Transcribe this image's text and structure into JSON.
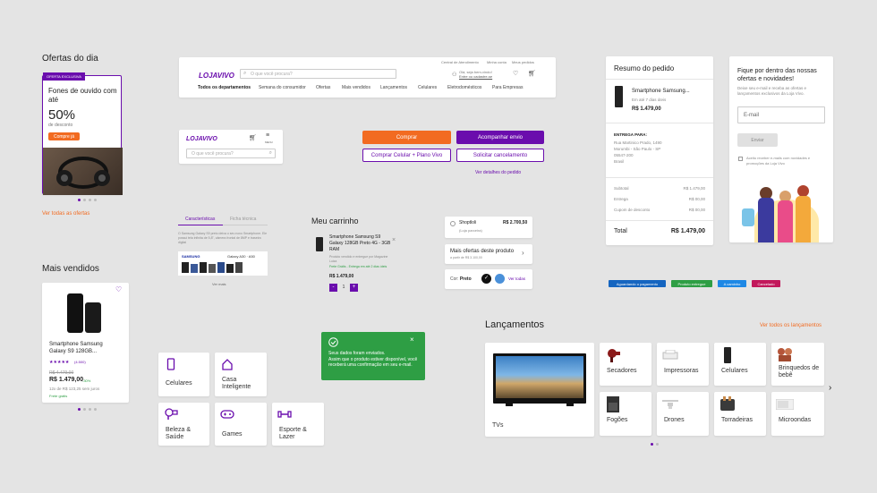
{
  "ofertas": {
    "title": "Ofertas do dia",
    "tag": "OFERTA EXCLUSIVA",
    "headline": "Fones de ouvido com até",
    "percent": "50%",
    "percent_sub": "de desconto",
    "cta": "Compre já",
    "link": "Ver todas as ofertas"
  },
  "header": {
    "logo": "LOJAVIVO",
    "search_placeholder": "O que você procura?",
    "top_links": [
      "Central de Atendimento",
      "Minha conta",
      "Meus pedidos"
    ],
    "greeting": "Olá, seja bem-vindo!",
    "greeting_link": "Entre ou cadastre-se",
    "nav": [
      "Todos os departamentos",
      "Semana do consumidor",
      "Ofertas",
      "Mais vendidos",
      "Lançamentos",
      "Celulares",
      "Eletrodomésticos",
      "Para Empresas"
    ]
  },
  "mobile_header": {
    "logo": "LOJAVIVO",
    "menu_label": "MENU",
    "search_placeholder": "O que você procura?"
  },
  "buttons": {
    "comprar": "Comprar",
    "acompanhar": "Acompanhar envio",
    "comprar_celular": "Comprar Celular + Plano Vivo",
    "solicitar": "Solicitar cancelamento",
    "ver_detalhes": "Ver detalhes do pedido"
  },
  "tabs": {
    "items": [
      "Características",
      "Ficha técnica"
    ],
    "text": "O Samsung Galaxy S9 preto deixa o seu novo Smartphone. Ele possui tela infinita de 5,8\", câmera frontal de 8MP e traseira digital",
    "image_brand": "SAMSUNG",
    "image_model": "Galaxy A30 · A50",
    "more": "Ver mais"
  },
  "carrinho": {
    "title": "Meu carrinho",
    "product": "Smartphone Samsung S9 Galaxy 128GB Preto 4G - 3GB RAM",
    "seller": "Produto vendido e entregue por Magazine Luiza",
    "shipping": "Frete Grátis - Entrega em até 2 dias úteis",
    "price": "R$ 1.479,00",
    "qty": "1",
    "minus": "-",
    "plus": "+"
  },
  "option": {
    "name": "Shoptloli",
    "sub": "(Loja parceira)",
    "price": "R$ 2.700,50"
  },
  "mais_ofertas": {
    "label": "Mais ofertas deste produto",
    "sub": "a partir de R$ 3.100,00"
  },
  "cor": {
    "label": "Cor:",
    "value": "Preto",
    "link": "Ver todas",
    "colors": [
      "#111111",
      "#4a90d9"
    ]
  },
  "mais_vendidos": {
    "title": "Mais vendidos",
    "product": "Smartphone Samsung Galaxy S9 128GB...",
    "reviews": "(4.500)",
    "stars": "★★★★★",
    "old_price": "R$ 4.479,00",
    "price": "R$ 1.479,00",
    "discount": "-30%",
    "installments": "12x de R$ 123,25 sem juros",
    "shipping": "Frete grátis"
  },
  "categories_small": [
    {
      "label": "Celulares",
      "icon": "phone-icon"
    },
    {
      "label": "Casa Inteligente",
      "icon": "house-icon"
    },
    {
      "label": "Beleza & Saúde",
      "icon": "hairdryer-icon"
    },
    {
      "label": "Games",
      "icon": "gamepad-icon"
    },
    {
      "label": "Esporte & Lazer",
      "icon": "dumbbell-icon"
    }
  ],
  "toast": {
    "line1": "Seus dados foram enviados.",
    "line2": "Assim que o produto estiver disponível, você receberá uma confirmação em seu e-mail."
  },
  "resumo": {
    "title": "Resumo do pedido",
    "product": "Smartphone Samsung...",
    "delivery": "Em até 7 dias úteis",
    "price": "R$ 1.479,00",
    "entrega_label": "ENTREGA PARA:",
    "address": [
      "Rua Martinico Prado, 1490",
      "Morumbi - São Paulo - SP",
      "05547-200",
      "Brasil"
    ],
    "rows": [
      {
        "k": "Subtotal",
        "v": "R$ 1.479,00"
      },
      {
        "k": "Entrega",
        "v": "R$ 00,00"
      },
      {
        "k": "Cupom de desconto",
        "v": "R$ 00,00"
      }
    ],
    "total_label": "Total",
    "total": "R$ 1.479,00"
  },
  "newsletter": {
    "title": "Fique por dentro das nossas ofertas e novidades!",
    "text": "Deixe seu e-mail e receba as ofertas e lançamentos exclusivos da Loja Vivo.",
    "email_placeholder": "E-mail",
    "button": "Enviar",
    "checkbox": "Aceito receber e-mails com novidades e promoções da Loja Vivo"
  },
  "status_badges": [
    {
      "label": "Aguardando o pagamento",
      "color": "#1565c0"
    },
    {
      "label": "Produto entregue",
      "color": "#2e9e44"
    },
    {
      "label": "A caminho",
      "color": "#1e88e5"
    },
    {
      "label": "Cancelado",
      "color": "#c2185b"
    }
  ],
  "lancamentos": {
    "title": "Lançamentos",
    "link": "Ver todos os lançamentos",
    "big": "TVs",
    "items": [
      "Secadores",
      "Impressoras",
      "Celulares",
      "Brinquedos de bebê",
      "Fogões",
      "Drones",
      "Torradeiras",
      "Microondas"
    ]
  },
  "colors": {
    "purple": "#6a0dad",
    "orange": "#f26b21",
    "green": "#2e9e44"
  }
}
